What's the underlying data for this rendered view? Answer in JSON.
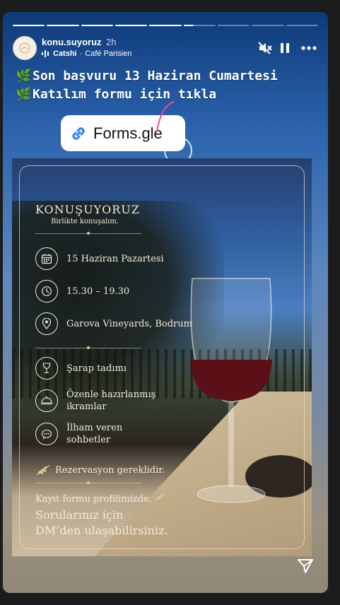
{
  "story": {
    "progress": [
      "full",
      "full",
      "full",
      "full",
      "full",
      "half",
      "empty",
      "empty",
      "empty"
    ],
    "header": {
      "username": "konu.suyoruz",
      "time": "2h",
      "music_artist": "Catshi",
      "music_sep": "·",
      "music_track": "Café Parisien"
    },
    "headline": {
      "line1": "Son başvuru 13 Haziran Cumartesi",
      "line2": "Katılım formu için tıkla",
      "leaf": "🌿"
    },
    "link_sticker": {
      "text": "Forms.gle"
    },
    "flyer": {
      "title": "KONUŞUYORUZ",
      "subtitle": "Birlikte konuşalım.",
      "date": "15 Haziran Pazartesi",
      "time": "15.30 – 19.30",
      "location": "Garova Vineyards, Bodrum",
      "item1": "Şarap tadımı",
      "item2_l1": "Özenle hazırlanmış",
      "item2_l2": "ikramlar",
      "item3_l1": "İlham veren",
      "item3_l2": "sohbetler",
      "reservation": "Rezervasyon gereklidir.",
      "form_note": "Kayıt formu profilimizde.",
      "questions_l1": "Sorularınız için",
      "questions_l2": "DM’den ulaşabilirsiniz."
    }
  },
  "colors": {
    "accent_leaf": "#6bc04b",
    "sticker_link": "#2f80ed",
    "cream": "#f3ead9",
    "gold": "#e6c78f"
  },
  "icons": [
    "mute-icon",
    "pause-icon",
    "more-icon",
    "music-icon",
    "link-icon",
    "calendar-icon",
    "clock-icon",
    "location-pin-icon",
    "wine-glass-icon",
    "cloche-icon",
    "chat-icon",
    "laurel-icon",
    "send-icon"
  ]
}
